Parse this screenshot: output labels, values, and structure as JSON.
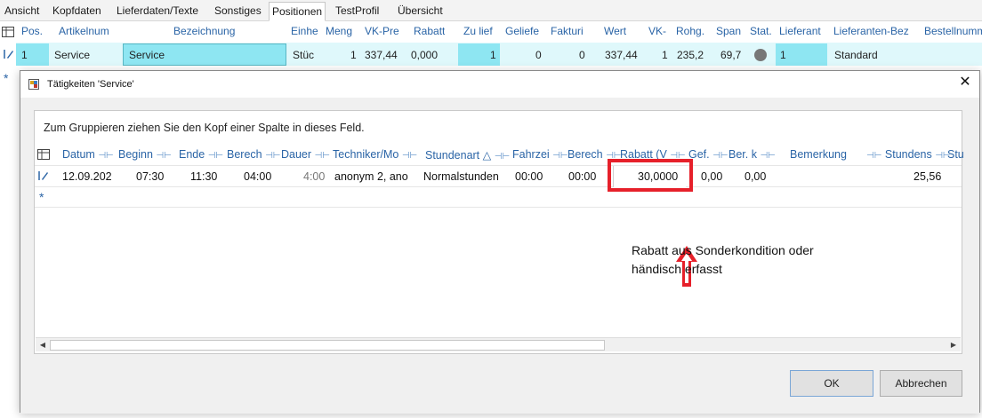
{
  "tabs": [
    "Ansicht",
    "Kopfdaten",
    "Lieferdaten/Texte",
    "Sonstiges",
    "Positionen",
    "TestProfil",
    "Übersicht"
  ],
  "active_tab": "Positionen",
  "positions_grid": {
    "headers": [
      "Pos.",
      "Artikelnum",
      "Bezeichnung",
      "Einhe",
      "Meng",
      "VK-Pre",
      "Rabatt",
      "Zu lief",
      "Geliefe",
      "Fakturi",
      "Wert",
      "VK-",
      "Rohg.",
      "Span",
      "Stat.",
      "Lieferant",
      "Lieferanten-Bez",
      "Bestellnumm"
    ],
    "row": {
      "pos": "1",
      "artikelnum": "Service",
      "bezeichnung": "Service",
      "einheit": "Stüc",
      "menge": "1",
      "vk_preis": "337,44",
      "rabatt": "0,000",
      "zu_liefern": "1",
      "geliefert": "0",
      "fakturiert": "0",
      "wert": "337,44",
      "vk": "1",
      "rohgewinn": "235,2",
      "spanne": "69,7",
      "lieferant": "1",
      "lieferanten_bez": "Standard"
    },
    "new_row_marker": "*"
  },
  "dialog": {
    "title": "Tätigkeiten 'Service'",
    "close_symbol": "✕",
    "group_hint": "Zum Gruppieren ziehen Sie den Kopf einer Spalte in dieses Feld.",
    "headers": [
      "Datum",
      "Beginn",
      "Ende",
      "Berech",
      "Dauer",
      "Techniker/Mo",
      "Stundenart",
      "Fahrzei",
      "Berech",
      "Rabatt (V",
      "Gef.",
      "Ber. k",
      "Bemerkung",
      "Stundens",
      "Stu"
    ],
    "sort_indicator": "△",
    "row": {
      "datum": "12.09.202",
      "beginn": "07:30",
      "ende": "11:30",
      "berechnet": "04:00",
      "dauer": "4:00",
      "techniker": "anonym 2, ano",
      "stundenart": "Normalstunden",
      "fahrzeit": "00:00",
      "berechnet2": "00:00",
      "rabatt": "30,0000",
      "gefahren": "0,00",
      "ber_km": "0,00",
      "bemerkung": "",
      "stundensatz": "25,56"
    },
    "new_row_marker": "*",
    "annotation": {
      "line1": "Rabatt aus Sonderkondition oder",
      "line2": "händisch erfasst",
      "highlight_color": "#e6202a"
    },
    "ok_label": "OK",
    "cancel_label": "Abbrechen"
  },
  "colors": {
    "header_blue": "#2a64a6",
    "selection_cyan": "#8ee6f2",
    "row_highlight": "#dff8fb"
  }
}
